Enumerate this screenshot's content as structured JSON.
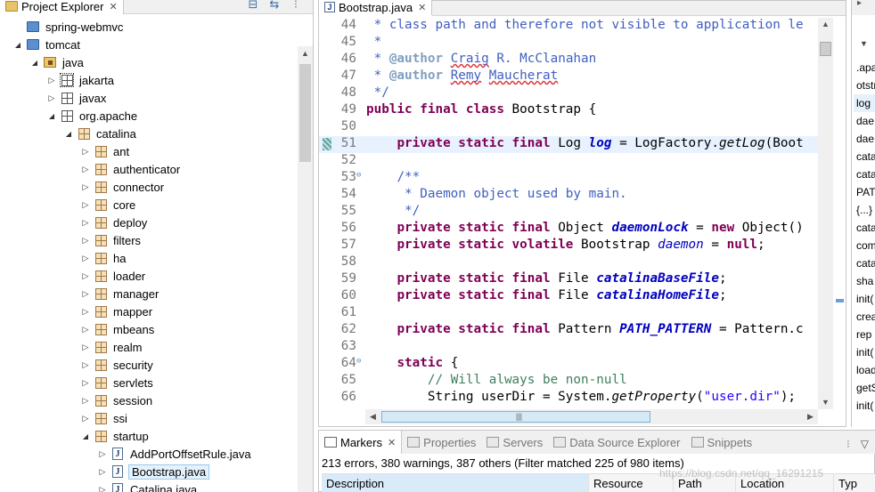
{
  "explorer": {
    "title": "Project Explorer",
    "close_glyph": "✕",
    "toolbar": [
      "collapse-all-icon",
      "link-with-editor-icon",
      "view-menu-icon"
    ],
    "tree": [
      {
        "label": "spring-webmvc",
        "indent": 0,
        "twisty": "",
        "icon": "project"
      },
      {
        "label": "tomcat",
        "indent": 0,
        "twisty": "◢",
        "icon": "project"
      },
      {
        "label": "java",
        "indent": 1,
        "twisty": "◢",
        "icon": "srcfolder"
      },
      {
        "label": "jakarta",
        "indent": 2,
        "twisty": "▷",
        "icon": "pkgdark",
        "selected": true
      },
      {
        "label": "javax",
        "indent": 2,
        "twisty": "▷",
        "icon": "pkgdark"
      },
      {
        "label": "org.apache",
        "indent": 2,
        "twisty": "◢",
        "icon": "pkgdark"
      },
      {
        "label": "catalina",
        "indent": 3,
        "twisty": "◢",
        "icon": "pkg"
      },
      {
        "label": "ant",
        "indent": 4,
        "twisty": "▷",
        "icon": "pkg"
      },
      {
        "label": "authenticator",
        "indent": 4,
        "twisty": "▷",
        "icon": "pkg"
      },
      {
        "label": "connector",
        "indent": 4,
        "twisty": "▷",
        "icon": "pkg"
      },
      {
        "label": "core",
        "indent": 4,
        "twisty": "▷",
        "icon": "pkg"
      },
      {
        "label": "deploy",
        "indent": 4,
        "twisty": "▷",
        "icon": "pkg"
      },
      {
        "label": "filters",
        "indent": 4,
        "twisty": "▷",
        "icon": "pkg"
      },
      {
        "label": "ha",
        "indent": 4,
        "twisty": "▷",
        "icon": "pkg"
      },
      {
        "label": "loader",
        "indent": 4,
        "twisty": "▷",
        "icon": "pkg"
      },
      {
        "label": "manager",
        "indent": 4,
        "twisty": "▷",
        "icon": "pkg"
      },
      {
        "label": "mapper",
        "indent": 4,
        "twisty": "▷",
        "icon": "pkg"
      },
      {
        "label": "mbeans",
        "indent": 4,
        "twisty": "▷",
        "icon": "pkg"
      },
      {
        "label": "realm",
        "indent": 4,
        "twisty": "▷",
        "icon": "pkg"
      },
      {
        "label": "security",
        "indent": 4,
        "twisty": "▷",
        "icon": "pkg"
      },
      {
        "label": "servlets",
        "indent": 4,
        "twisty": "▷",
        "icon": "pkg"
      },
      {
        "label": "session",
        "indent": 4,
        "twisty": "▷",
        "icon": "pkg"
      },
      {
        "label": "ssi",
        "indent": 4,
        "twisty": "▷",
        "icon": "pkg"
      },
      {
        "label": "startup",
        "indent": 4,
        "twisty": "◢",
        "icon": "pkg"
      },
      {
        "label": "AddPortOffsetRule.java",
        "indent": 5,
        "twisty": "▷",
        "icon": "java"
      },
      {
        "label": "Bootstrap.java",
        "indent": 5,
        "twisty": "▷",
        "icon": "java",
        "highlight": true
      },
      {
        "label": "Catalina.java",
        "indent": 5,
        "twisty": "▷",
        "icon": "java"
      }
    ]
  },
  "editor": {
    "tab_title": "Bootstrap.java",
    "tab_icon_letter": "J",
    "close_glyph": "✕",
    "lines": [
      {
        "n": "44",
        "html": "<span class=\"jd\"> * class path and therefore not visible to application le</span>"
      },
      {
        "n": "45",
        "html": "<span class=\"jd\"> *</span>"
      },
      {
        "n": "46",
        "html": "<span class=\"jd\"> * <span class=\"tag\">@author</span> <span class=\"sq\">Craig</span> R. McClanahan</span>"
      },
      {
        "n": "47",
        "html": "<span class=\"jd\"> * <span class=\"tag\">@author</span> <span class=\"sq\">Remy</span> <span class=\"sq\">Maucherat</span></span>"
      },
      {
        "n": "48",
        "html": "<span class=\"jd\"> */</span>"
      },
      {
        "n": "49",
        "html": "<span class=\"kw\">public final class</span> Bootstrap {"
      },
      {
        "n": "50",
        "html": ""
      },
      {
        "n": "51",
        "html": "    <span class=\"kw\">private static final</span> Log <span class=\"fld\">log</span> = LogFactory.<span class=\"it\">getLog</span>(Boot",
        "current": true,
        "occurrence": true
      },
      {
        "n": "52",
        "html": ""
      },
      {
        "n": "53",
        "html": "    <span class=\"jd\">/**</span>",
        "fold": true
      },
      {
        "n": "54",
        "html": "<span class=\"jd\">     * Daemon object used by main.</span>"
      },
      {
        "n": "55",
        "html": "<span class=\"jd\">     */</span>"
      },
      {
        "n": "56",
        "html": "    <span class=\"kw\">private static final</span> Object <span class=\"fld\">daemonLock</span> = <span class=\"kw\">new</span> Object()"
      },
      {
        "n": "57",
        "html": "    <span class=\"kw\">private static volatile</span> Bootstrap <span class=\"fld2\">daemon</span> = <span class=\"kw\">null</span>;"
      },
      {
        "n": "58",
        "html": ""
      },
      {
        "n": "59",
        "html": "    <span class=\"kw\">private static final</span> File <span class=\"fld\">catalinaBaseFile</span>;"
      },
      {
        "n": "60",
        "html": "    <span class=\"kw\">private static final</span> File <span class=\"fld\">catalinaHomeFile</span>;"
      },
      {
        "n": "61",
        "html": ""
      },
      {
        "n": "62",
        "html": "    <span class=\"kw\">private static final</span> Pattern <span class=\"fld\">PATH_PATTERN</span> = Pattern.c"
      },
      {
        "n": "63",
        "html": ""
      },
      {
        "n": "64",
        "html": "    <span class=\"kw\">static</span> {",
        "fold": true
      },
      {
        "n": "65",
        "html": "        <span class=\"cm\">// Will always be non-null</span>"
      },
      {
        "n": "66",
        "html": "        String userDir = System.<span class=\"it\">getProperty</span>(<span class=\"st\">\"user.dir\"</span>);"
      }
    ]
  },
  "outline": {
    "items": [
      ".apa",
      "otstra",
      "log",
      "dae",
      "dae",
      "cata",
      "cata",
      "PAT",
      "{...}",
      "cata",
      "com",
      "cata",
      "sha",
      "init(",
      "crea",
      "rep",
      "init(",
      "load",
      "getS",
      "init("
    ],
    "selected_index": 2
  },
  "markers": {
    "tabs": [
      {
        "label": "Markers",
        "active": true
      },
      {
        "label": "Properties"
      },
      {
        "label": "Servers"
      },
      {
        "label": "Data Source Explorer"
      },
      {
        "label": "Snippets"
      }
    ],
    "summary": "213 errors, 380 warnings, 387 others (Filter matched 225 of 980 items)",
    "columns": [
      "Description",
      "Resource",
      "Path",
      "Location",
      "Typ"
    ],
    "watermark": "https://blog.csdn.net/qq_16291215"
  }
}
